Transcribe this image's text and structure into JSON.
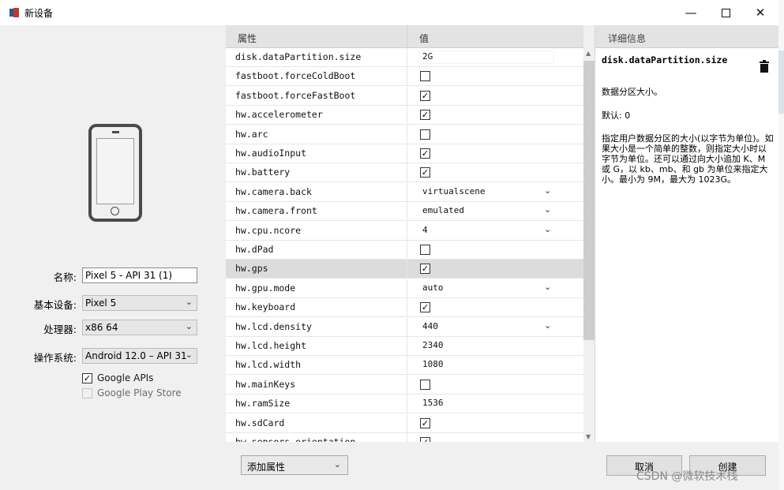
{
  "window": {
    "title": "新设备"
  },
  "form": {
    "name_label": "名称:",
    "name_value": "Pixel 5 - API 31 (1)",
    "base_device_label": "基本设备:",
    "base_device_value": "Pixel 5",
    "processor_label": "处理器:",
    "processor_value": "x86 64",
    "os_label": "操作系统:",
    "os_value": "Android 12.0 – API 31",
    "google_apis_label": "Google APIs",
    "google_apis_checked": true,
    "google_play_label": "Google Play Store",
    "google_play_checked": false
  },
  "table": {
    "col_property": "属性",
    "col_value": "值",
    "rows": [
      {
        "key": "disk.dataPartition.size",
        "type": "text",
        "value": "2G"
      },
      {
        "key": "fastboot.forceColdBoot",
        "type": "check",
        "checked": false
      },
      {
        "key": "fastboot.forceFastBoot",
        "type": "check",
        "checked": true
      },
      {
        "key": "hw.accelerometer",
        "type": "check",
        "checked": true
      },
      {
        "key": "hw.arc",
        "type": "check",
        "checked": false
      },
      {
        "key": "hw.audioInput",
        "type": "check",
        "checked": true
      },
      {
        "key": "hw.battery",
        "type": "check",
        "checked": true
      },
      {
        "key": "hw.camera.back",
        "type": "select",
        "value": "virtualscene"
      },
      {
        "key": "hw.camera.front",
        "type": "select",
        "value": "emulated"
      },
      {
        "key": "hw.cpu.ncore",
        "type": "select",
        "value": "4"
      },
      {
        "key": "hw.dPad",
        "type": "check",
        "checked": false
      },
      {
        "key": "hw.gps",
        "type": "check",
        "checked": true,
        "selected": true
      },
      {
        "key": "hw.gpu.mode",
        "type": "select",
        "value": "auto"
      },
      {
        "key": "hw.keyboard",
        "type": "check",
        "checked": true
      },
      {
        "key": "hw.lcd.density",
        "type": "select",
        "value": "440"
      },
      {
        "key": "hw.lcd.height",
        "type": "plain",
        "value": "2340"
      },
      {
        "key": "hw.lcd.width",
        "type": "plain",
        "value": "1080"
      },
      {
        "key": "hw.mainKeys",
        "type": "check",
        "checked": false
      },
      {
        "key": "hw.ramSize",
        "type": "plain",
        "value": "1536"
      },
      {
        "key": "hw.sdCard",
        "type": "check",
        "checked": true
      },
      {
        "key": "hw.sensors.orientation",
        "type": "check",
        "checked": true
      }
    ]
  },
  "detail": {
    "header": "详细信息",
    "key": "disk.dataPartition.size",
    "summary": "数据分区大小。",
    "default": "默认: 0",
    "description": "指定用户数据分区的大小(以字节为单位)。如果大小是一个简单的整数，则指定大小时以字节为单位。还可以通过向大小追加 K、M 或 G，以 kb、mb、和 gb 为单位来指定大小。最小为 9M，最大为 1023G。"
  },
  "bottom": {
    "add_property": "添加属性",
    "cancel": "取消",
    "create": "创建"
  },
  "watermark": "CSDN @微软技术栈",
  "icons": {
    "minimize": "minimize-icon",
    "maximize": "maximize-icon",
    "close": "close-icon",
    "trash": "trash-icon",
    "phone": "phone-icon"
  }
}
